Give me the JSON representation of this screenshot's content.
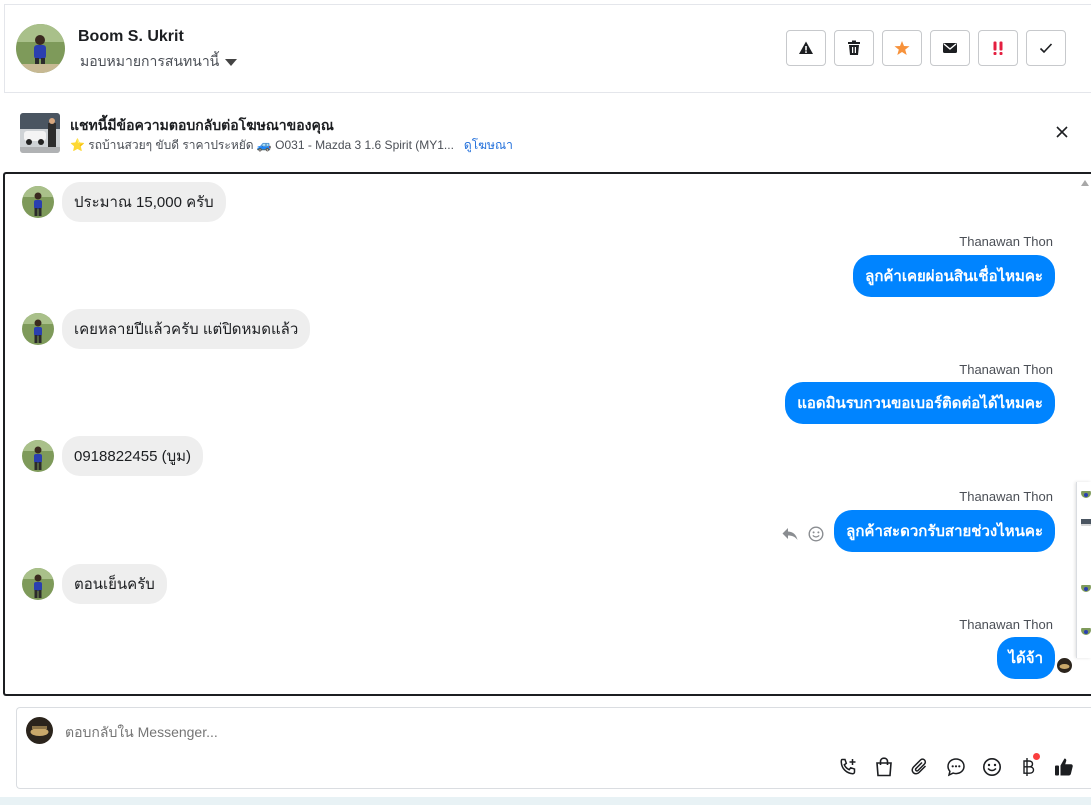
{
  "header": {
    "contact_name": "Boom S. Ukrit",
    "assign_label": "มอบหมายการสนทนานี้",
    "actions": [
      {
        "name": "report-icon",
        "color": "#1c1e21"
      },
      {
        "name": "trash-icon",
        "color": "#1c1e21"
      },
      {
        "name": "star-icon",
        "color": "#f7923b"
      },
      {
        "name": "mail-icon",
        "color": "#1c1e21"
      },
      {
        "name": "important-icon",
        "color": "#e41e3f"
      },
      {
        "name": "checkmark-icon",
        "color": "#1c1e21"
      }
    ]
  },
  "ad_banner": {
    "title": "แชทนี้มีข้อความตอบกลับต่อโฆษณาของคุณ",
    "subtitle": "⭐ รถบ้านสวยๆ ขับดี ราคาประหยัด 🚙 O031 - Mazda 3 1.6 Spirit (MY1...",
    "link_label": "ดูโฆษณา"
  },
  "messages": [
    {
      "direction": "in",
      "text": "ประมาณ 15,000 ครับ"
    },
    {
      "direction": "out",
      "sender": "Thanawan Thon",
      "text": "ลูกค้าเคยผ่อนสินเชื่อไหมคะ"
    },
    {
      "direction": "in",
      "text": "เคยหลายปีแล้วครับ แต่ปิดหมดแล้ว"
    },
    {
      "direction": "out",
      "sender": "Thanawan Thon",
      "text": "แอดมินรบกวนขอเบอร์ติดต่อได้ไหมคะ"
    },
    {
      "direction": "in",
      "text": "0918822455 (บูม)"
    },
    {
      "direction": "out",
      "sender": "Thanawan Thon",
      "text": "ลูกค้าสะดวกรับสายช่วงไหนคะ"
    },
    {
      "direction": "in",
      "text": "ตอนเย็นครับ"
    },
    {
      "direction": "out",
      "sender": "Thanawan Thon",
      "text": "ได้จ้า"
    }
  ],
  "composer": {
    "placeholder": "ตอบกลับใน Messenger...",
    "tools": [
      "add-call-icon",
      "shopping-bag-icon",
      "paperclip-icon",
      "saved-reply-icon",
      "emoji-icon",
      "baht-icon",
      "thumbs-up-icon"
    ]
  },
  "colors": {
    "outgoing_bubble": "#0084ff",
    "incoming_bubble": "#eeeeee",
    "link": "#216fdb"
  }
}
